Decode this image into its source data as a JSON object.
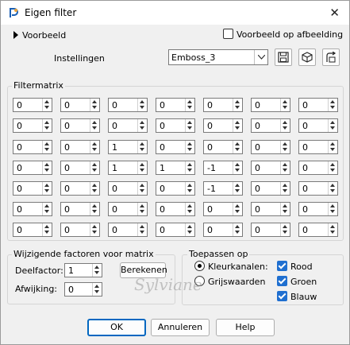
{
  "window": {
    "title": "Eigen filter",
    "close_glyph": "✕"
  },
  "preview": {
    "toggle_label": "Voorbeeld",
    "on_image_label": "Voorbeeld op afbeelding",
    "on_image_checked": false
  },
  "settings": {
    "label": "Instellingen",
    "preset_value": "Emboss_3"
  },
  "matrix": {
    "label": "Filtermatrix",
    "rows": [
      [
        "0",
        "0",
        "0",
        "0",
        "0",
        "0",
        "0"
      ],
      [
        "0",
        "0",
        "0",
        "0",
        "0",
        "0",
        "0"
      ],
      [
        "0",
        "0",
        "1",
        "0",
        "0",
        "0",
        "0"
      ],
      [
        "0",
        "0",
        "1",
        "1",
        "-1",
        "0",
        "0"
      ],
      [
        "0",
        "0",
        "0",
        "0",
        "-1",
        "0",
        "0"
      ],
      [
        "0",
        "0",
        "0",
        "0",
        "0",
        "0",
        "0"
      ],
      [
        "0",
        "0",
        "0",
        "0",
        "0",
        "0",
        "0"
      ]
    ]
  },
  "factors": {
    "label": "Wijzigende factoren voor matrix",
    "divisor_label": "Deelfactor:",
    "divisor_value": "1",
    "bias_label": "Afwijking:",
    "bias_value": "0",
    "compute_label": "Berekenen"
  },
  "apply": {
    "label": "Toepassen op",
    "color_channels_label": "Kleurkanalen:",
    "grayscale_label": "Grijswaarden",
    "mode": "color",
    "channels": [
      {
        "label": "Rood",
        "checked": true
      },
      {
        "label": "Groen",
        "checked": true
      },
      {
        "label": "Blauw",
        "checked": true
      }
    ]
  },
  "buttons": {
    "ok": "OK",
    "cancel": "Annuleren",
    "help": "Help"
  },
  "watermark": "Sylviane",
  "colors": {
    "accent": "#0067c0",
    "checkbox_blue": "#1f6fd0",
    "background": "#f0f0f0"
  }
}
